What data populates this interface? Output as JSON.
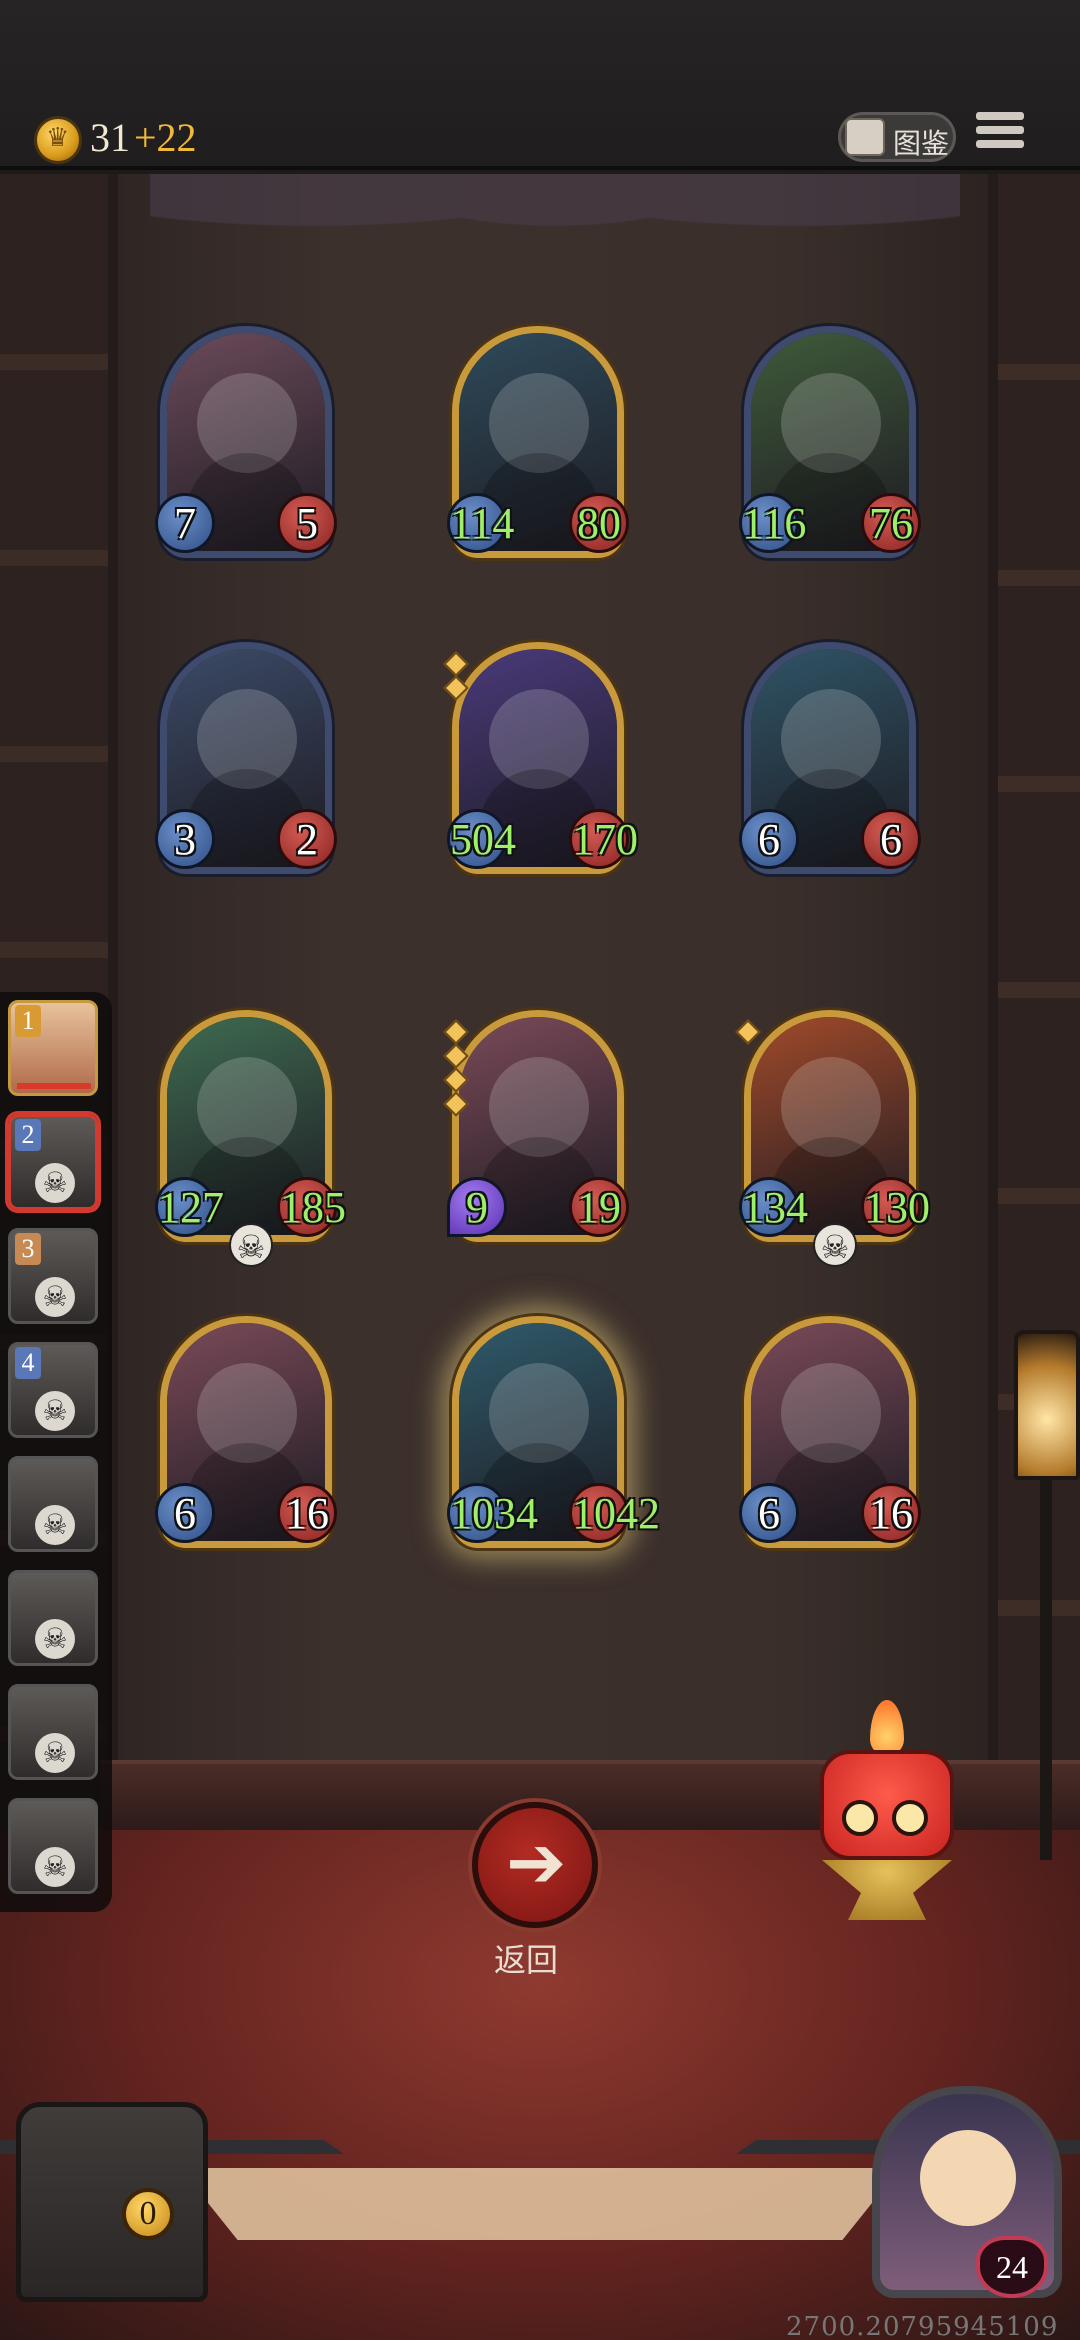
{
  "header": {
    "gold": "31",
    "gold_income": "+22",
    "codex_label": "图鉴",
    "icons": {
      "coin": "crown-coin-icon",
      "codex": "book-icon",
      "menu": "hamburger-menu-icon"
    }
  },
  "board": {
    "rows": [
      [
        {
          "attack": "7",
          "health": "5",
          "frame": "blue",
          "atk_buffed": false,
          "hp_buffed": false,
          "theme": "#6b4a5a"
        },
        {
          "attack": "114",
          "health": "80",
          "frame": "gold",
          "atk_buffed": true,
          "hp_buffed": true,
          "theme": "#2f4a5a"
        },
        {
          "attack": "116",
          "health": "76",
          "frame": "blue",
          "atk_buffed": true,
          "hp_buffed": true,
          "theme": "#3f5a3a"
        }
      ],
      [
        {
          "attack": "3",
          "health": "2",
          "frame": "blue",
          "atk_buffed": false,
          "hp_buffed": false,
          "theme": "#3b4a66"
        },
        {
          "attack": "504",
          "health": "170",
          "frame": "gold",
          "atk_buffed": true,
          "hp_buffed": true,
          "stars": 2,
          "theme": "#4a3a7a"
        },
        {
          "attack": "6",
          "health": "6",
          "frame": "blue",
          "atk_buffed": false,
          "hp_buffed": false,
          "theme": "#2f5466"
        }
      ],
      [
        {
          "attack": "127",
          "health": "185",
          "frame": "gold",
          "atk_buffed": true,
          "hp_buffed": true,
          "skull": true,
          "theme": "#3e6a50"
        },
        {
          "attack": "9",
          "health": "19",
          "frame": "gold",
          "atk_buffed": true,
          "hp_buffed": true,
          "stars": 4,
          "atk_style": "purple",
          "theme": "#7a4a58"
        },
        {
          "attack": "134",
          "health": "130",
          "frame": "gold",
          "atk_buffed": true,
          "hp_buffed": true,
          "stars": 1,
          "skull": true,
          "theme": "#a04a2a"
        }
      ],
      [
        {
          "attack": "6",
          "health": "16",
          "frame": "gold",
          "atk_buffed": false,
          "hp_buffed": false,
          "theme": "#7a4a58"
        },
        {
          "attack": "1034",
          "health": "1042",
          "frame": "gold",
          "atk_buffed": true,
          "hp_buffed": true,
          "glow": true,
          "theme": "#2f5a6a"
        },
        {
          "attack": "6",
          "health": "16",
          "frame": "gold",
          "atk_buffed": false,
          "hp_buffed": false,
          "theme": "#7a4a58"
        }
      ]
    ],
    "skull_icon": "skull-icon"
  },
  "history": [
    {
      "num": "1",
      "state": "active"
    },
    {
      "num": "2",
      "state": "selected",
      "skull": true
    },
    {
      "num": "3",
      "skull": true
    },
    {
      "num": "4",
      "skull": true
    },
    {
      "num": "",
      "skull": true
    },
    {
      "num": "",
      "skull": true
    },
    {
      "num": "",
      "skull": true
    },
    {
      "num": "",
      "skull": true
    }
  ],
  "return": {
    "label": "返回",
    "icon": "arrow-left-icon"
  },
  "treasure": {
    "count": "0",
    "icon": "treasure-chest-icon"
  },
  "hero": {
    "health": "24"
  },
  "footer": {
    "code": "2700.20795945109"
  }
}
